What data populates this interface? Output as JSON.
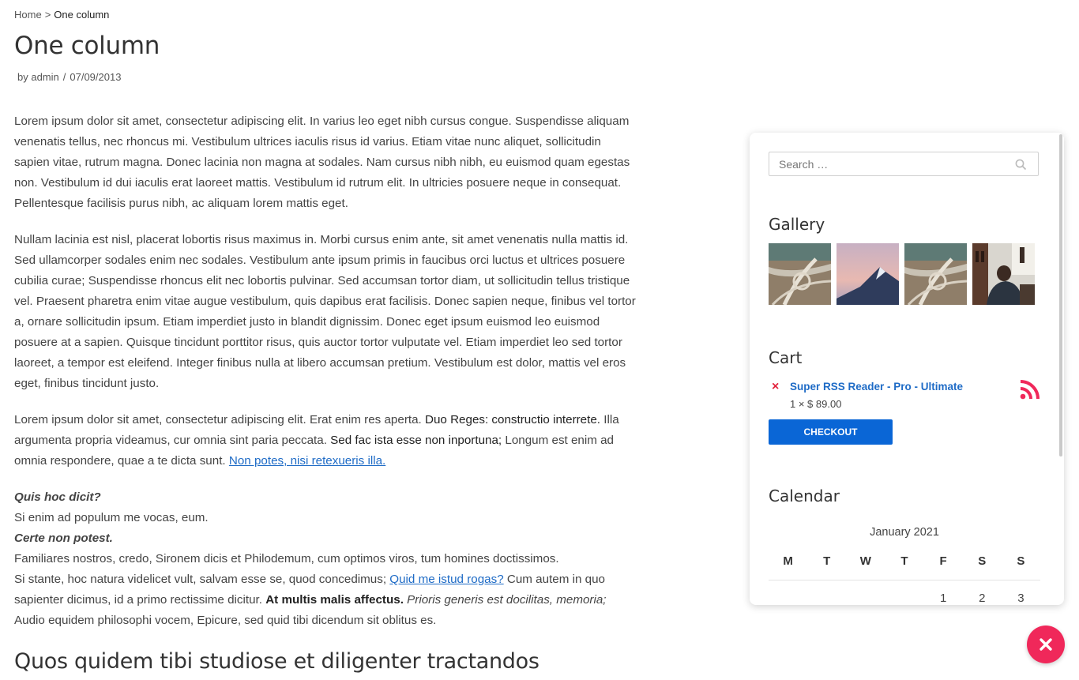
{
  "breadcrumb": {
    "home": "Home",
    "separator": ">",
    "current": "One column"
  },
  "post": {
    "title": "One column",
    "author": "by admin",
    "divider": "/",
    "date": "07/09/2013"
  },
  "content": {
    "p1": "Lorem ipsum dolor sit amet, consectetur adipiscing elit. In varius leo eget nibh cursus congue. Suspendisse aliquam venenatis tellus, nec rhoncus mi. Vestibulum ultrices iaculis risus id varius. Etiam vitae nunc aliquet, sollicitudin sapien vitae, rutrum magna. Donec lacinia non magna at sodales. Nam cursus nibh nibh, eu euismod quam egestas non. Vestibulum id dui iaculis erat laoreet mattis. Vestibulum id rutrum elit. In ultricies posuere neque in consequat. Pellentesque facilisis purus nibh, ac aliquam lorem mattis eget.",
    "p2": "Nullam lacinia est nisl, placerat lobortis risus maximus in. Morbi cursus enim ante, sit amet venenatis nulla mattis id. Sed ullamcorper sodales enim nec sodales. Vestibulum ante ipsum primis in faucibus orci luctus et ultrices posuere cubilia curae; Suspendisse rhoncus elit nec lobortis pulvinar. Sed accumsan tortor diam, ut sollicitudin tellus tristique vel. Praesent pharetra enim vitae augue vestibulum, quis dapibus erat facilisis. Donec sapien neque, finibus vel tortor a, ornare sollicitudin ipsum. Etiam imperdiet justo in blandit dignissim. Donec eget ipsum euismod leo euismod posuere at a sapien. Quisque tincidunt porttitor risus, quis auctor tortor vulputate vel. Etiam imperdiet leo sed tortor laoreet, a tempor est eleifend. Integer finibus nulla at libero accumsan pretium. Vestibulum est dolor, mattis vel eros eget, finibus tincidunt justo.",
    "p3_a": "Lorem ipsum dolor sit amet, consectetur adipiscing elit. Erat enim res aperta.",
    "p3_b": "Duo Reges: constructio interrete.",
    "p3_c": "Illa argumenta propria videamus, cur omnia sint paria peccata.",
    "p3_d": "Sed fac ista esse non inportuna;",
    "p3_e": "Longum est enim ad omnia respondere, quae a te dicta sunt.",
    "p3_link": "Non potes, nisi retexueris illa.",
    "q1": "Quis hoc dicit?",
    "a1": "Si enim ad populum me vocas, eum.",
    "q2": "Certe non potest.",
    "a2": "Familiares nostros, credo, Sironem dicis et Philodemum, cum optimos viros, tum homines doctissimos.",
    "p4_a": "Si stante, hoc natura videlicet vult, salvam esse se, quod concedimus;",
    "p4_link": "Quid me istud rogas?",
    "p4_b": "Cum autem in quo sapienter dicimus, id a primo rectissime dicitur.",
    "p4_bold": "At multis malis affectus.",
    "p4_italic": "Prioris generis est docilitas, memoria;",
    "p4_c": "Audio equidem philosophi vocem, Epicure, sed quid tibi dicendum sit oblitus es.",
    "subheading": "Quos quidem tibi studiose et diligenter tractandos"
  },
  "sidebar": {
    "search": {
      "placeholder": "Search …"
    },
    "gallery": {
      "title": "Gallery",
      "images": [
        "highway-interchange-aerial",
        "mountain-peak-pink-sky",
        "highway-interchange-aerial",
        "person-in-cafe"
      ]
    },
    "cart": {
      "title": "Cart",
      "remove": "×",
      "product": "Super RSS Reader - Pro - Ultimate",
      "quantity": "1 × $ 89.00",
      "checkout": "CHECKOUT"
    },
    "calendar": {
      "title": "Calendar",
      "caption": "January 2021",
      "days": [
        "M",
        "T",
        "W",
        "T",
        "F",
        "S",
        "S"
      ],
      "first_row": [
        "",
        "",
        "",
        "",
        "1",
        "2",
        "3"
      ]
    }
  },
  "colors": {
    "link": "#1e6bc6",
    "checkout": "#0a66d6",
    "rss": "#f0285a",
    "fab": "#f0285a",
    "remove": "#e2223b"
  }
}
